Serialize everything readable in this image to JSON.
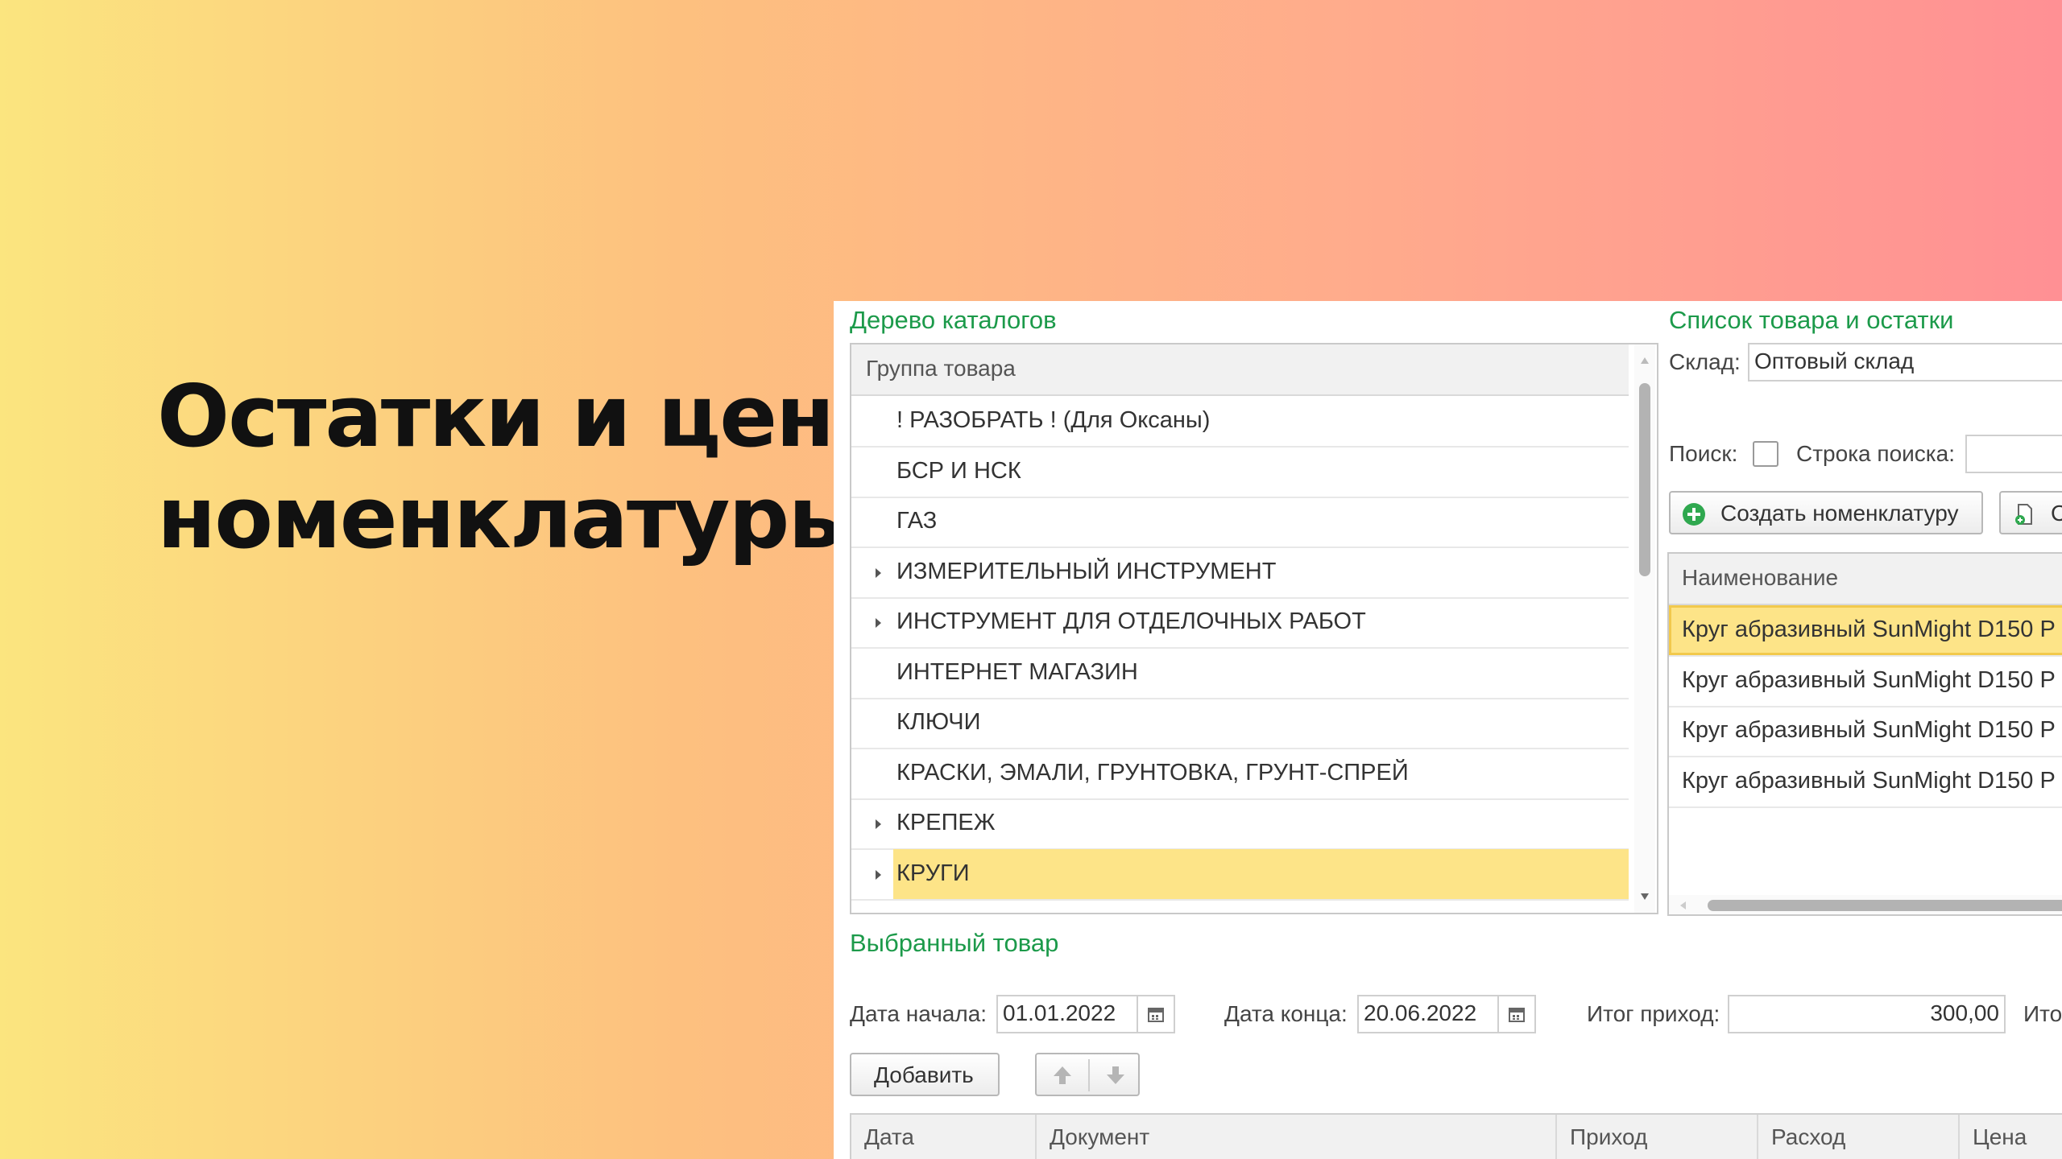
{
  "headline": {
    "line1": "Остатки и цены",
    "line2": "номенклатуры"
  },
  "catalog_tree": {
    "title": "Дерево каталогов",
    "header": "Группа товара",
    "items": [
      {
        "label": "! РАЗОБРАТЬ ! (Для Оксаны)",
        "expandable": false
      },
      {
        "label": "БСР И НСК",
        "expandable": false
      },
      {
        "label": "ГАЗ",
        "expandable": false
      },
      {
        "label": "ИЗМЕРИТЕЛЬНЫЙ ИНСТРУМЕНТ",
        "expandable": true
      },
      {
        "label": "ИНСТРУМЕНТ ДЛЯ ОТДЕЛОЧНЫХ РАБОТ",
        "expandable": true
      },
      {
        "label": "ИНТЕРНЕТ МАГАЗИН",
        "expandable": false
      },
      {
        "label": "КЛЮЧИ",
        "expandable": false
      },
      {
        "label": "КРАСКИ, ЭМАЛИ, ГРУНТОВКА, ГРУНТ-СПРЕЙ",
        "expandable": false
      },
      {
        "label": "КРЕПЕЖ",
        "expandable": true
      },
      {
        "label": "КРУГИ",
        "expandable": true,
        "selected": true
      }
    ]
  },
  "product_list": {
    "title": "Список товара и остатки",
    "warehouse_label": "Склад:",
    "warehouse_value": "Оптовый склад",
    "search_label": "Поиск:",
    "search_string_label": "Строка поиска:",
    "search_string_value": "",
    "create_button": "Создать номенклатуру",
    "second_button": "С",
    "column_name": "Наименование",
    "rows": [
      "Круг абразивный SunMight D150 P",
      "Круг абразивный SunMight D150 P",
      "Круг абразивный SunMight D150 P",
      "Круг абразивный SunMight D150 P"
    ]
  },
  "selected_product": {
    "title": "Выбранный товар",
    "date_start_label": "Дата начала:",
    "date_start_value": "01.01.2022",
    "date_end_label": "Дата конца:",
    "date_end_value": "20.06.2022",
    "total_in_label": "Итог приход:",
    "total_in_value": "300,00",
    "total_out_label": "Итог",
    "add_button": "Добавить",
    "columns": [
      "Дата",
      "Документ",
      "Приход",
      "Расход",
      "Цена"
    ]
  },
  "colors": {
    "section_title": "#1c9a4a",
    "selection": "#fde488",
    "selection_border": "#f2c94c",
    "add_icon": "#2fa84f"
  },
  "icons": {
    "calendar": "calendar-icon",
    "add": "plus-circle-icon",
    "copy": "document-copy-icon",
    "move_up": "arrow-up-icon",
    "move_down": "arrow-down-icon"
  }
}
